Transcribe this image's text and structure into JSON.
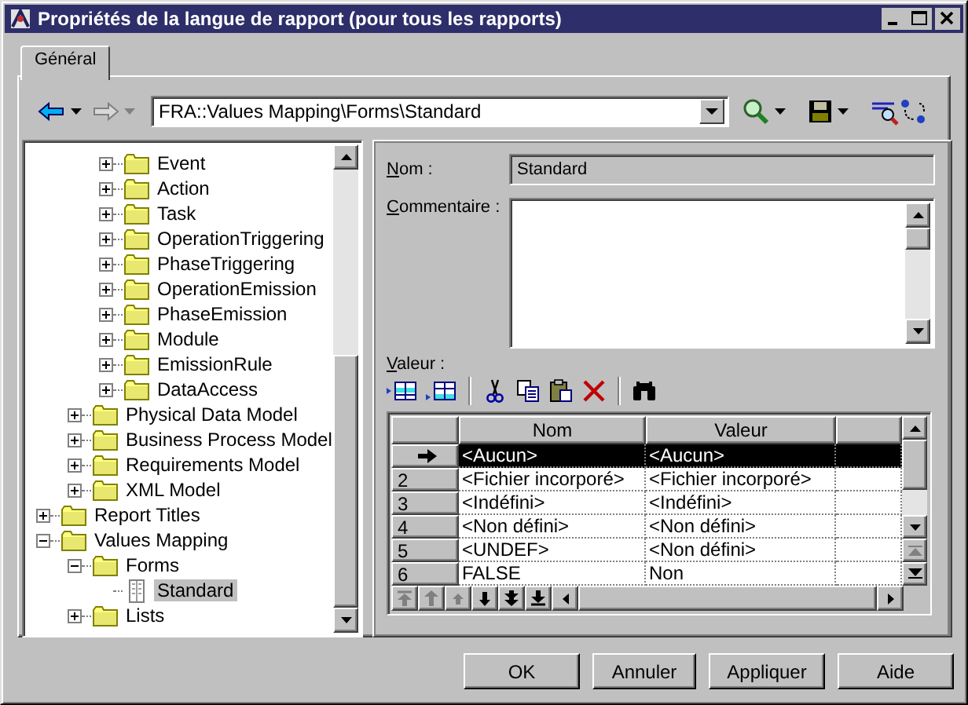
{
  "window": {
    "title": "Propriétés de la langue de rapport (pour tous les rapports)"
  },
  "tabs": [
    {
      "label": "Général",
      "selected": true
    }
  ],
  "toolbar": {
    "path": "FRA::Values Mapping\\Forms\\Standard"
  },
  "tree": [
    {
      "children": [
        {
          "children": [
            {
              "label": "Event",
              "kind": "folder",
              "expanded": false,
              "selected": false
            },
            {
              "label": "Action",
              "kind": "folder",
              "expanded": false,
              "selected": false
            },
            {
              "label": "Task",
              "kind": "folder",
              "expanded": false,
              "selected": false
            },
            {
              "label": "OperationTriggering",
              "kind": "folder",
              "expanded": false,
              "selected": false
            },
            {
              "label": "PhaseTriggering",
              "kind": "folder",
              "expanded": false,
              "selected": false
            },
            {
              "label": "OperationEmission",
              "kind": "folder",
              "expanded": false,
              "selected": false
            },
            {
              "label": "PhaseEmission",
              "kind": "folder",
              "expanded": false,
              "selected": false
            },
            {
              "label": "Module",
              "kind": "folder",
              "expanded": false,
              "selected": false
            },
            {
              "label": "EmissionRule",
              "kind": "folder",
              "expanded": false,
              "selected": false
            },
            {
              "label": "DataAccess",
              "kind": "folder",
              "expanded": false,
              "selected": false
            }
          ]
        },
        {
          "label": "Physical Data Model",
          "kind": "folder",
          "expanded": false,
          "selected": false
        },
        {
          "label": "Business Process Model",
          "kind": "folder",
          "expanded": false,
          "selected": false
        },
        {
          "label": "Requirements Model",
          "kind": "folder",
          "expanded": false,
          "selected": false
        },
        {
          "label": "XML Model",
          "kind": "folder",
          "expanded": false,
          "selected": false
        }
      ]
    },
    {
      "label": "Report Titles",
      "kind": "folder",
      "expanded": false,
      "selected": false
    },
    {
      "label": "Values Mapping",
      "kind": "folder",
      "expanded": true,
      "selected": false,
      "children": [
        {
          "label": "Forms",
          "kind": "folder",
          "expanded": true,
          "selected": false,
          "children": [
            {
              "label": "Standard",
              "kind": "form",
              "selected": true
            }
          ]
        },
        {
          "label": "Lists",
          "kind": "folder",
          "expanded": false,
          "selected": false
        }
      ]
    }
  ],
  "form": {
    "name_label": "Nom :",
    "name_value": "Standard",
    "comment_label": "Commentaire :",
    "value_label": "Valeur :"
  },
  "grid": {
    "columns": [
      "Nom",
      "Valeur"
    ],
    "rows": [
      {
        "selected": true,
        "nom": "<Aucun>",
        "valeur": "<Aucun>"
      },
      {
        "selected": false,
        "number": "2",
        "nom": "<Fichier incorporé>",
        "valeur": "<Fichier incorporé>"
      },
      {
        "selected": false,
        "number": "3",
        "nom": "<Indéfini>",
        "valeur": "<Indéfini>"
      },
      {
        "selected": false,
        "number": "4",
        "nom": "<Non défini>",
        "valeur": "<Non défini>"
      },
      {
        "selected": false,
        "number": "5",
        "nom": "<UNDEF>",
        "valeur": "<Non défini>"
      },
      {
        "selected": false,
        "number": "6",
        "nom": "FALSE",
        "valeur": "Non"
      }
    ]
  },
  "buttons": [
    {
      "label": "OK"
    },
    {
      "label": "Annuler"
    },
    {
      "label": "Appliquer"
    },
    {
      "label": "Aide"
    }
  ]
}
